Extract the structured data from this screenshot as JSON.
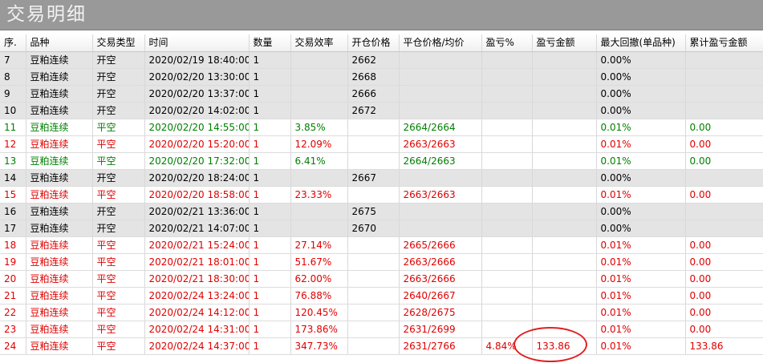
{
  "window": {
    "title": "交易明细"
  },
  "table": {
    "columns": [
      {
        "key": "seq",
        "label": "序."
      },
      {
        "key": "product",
        "label": "品种"
      },
      {
        "key": "trade_type",
        "label": "交易类型"
      },
      {
        "key": "time",
        "label": "时间"
      },
      {
        "key": "qty",
        "label": "数量"
      },
      {
        "key": "efficiency",
        "label": "交易效率"
      },
      {
        "key": "open_price",
        "label": "开仓价格"
      },
      {
        "key": "close_avg",
        "label": "平仓价格/均价"
      },
      {
        "key": "pnl_pct",
        "label": "盈亏%"
      },
      {
        "key": "pnl_amount",
        "label": "盈亏金额"
      },
      {
        "key": "max_drawdown",
        "label": "最大回撤(单品种)"
      },
      {
        "key": "cum_pnl",
        "label": "累计盈亏金额"
      }
    ],
    "rows": [
      {
        "status": "pending",
        "cells": [
          "7",
          "豆粕连续",
          "开空",
          "2020/02/19 18:40:00",
          "1",
          "",
          "2662",
          "",
          "",
          "",
          "0.00%",
          ""
        ]
      },
      {
        "status": "pending",
        "cells": [
          "8",
          "豆粕连续",
          "开空",
          "2020/02/20 13:30:00",
          "1",
          "",
          "2668",
          "",
          "",
          "",
          "0.00%",
          ""
        ]
      },
      {
        "status": "pending",
        "cells": [
          "9",
          "豆粕连续",
          "开空",
          "2020/02/20 13:37:00",
          "1",
          "",
          "2666",
          "",
          "",
          "",
          "0.00%",
          ""
        ]
      },
      {
        "status": "pending",
        "cells": [
          "10",
          "豆粕连续",
          "开空",
          "2020/02/20 14:02:00",
          "1",
          "",
          "2672",
          "",
          "",
          "",
          "0.00%",
          ""
        ]
      },
      {
        "status": "profit",
        "cells": [
          "11",
          "豆粕连续",
          "平空",
          "2020/02/20 14:55:00",
          "1",
          "3.85%",
          "",
          "2664/2664",
          "",
          "",
          "0.01%",
          "0.00"
        ]
      },
      {
        "status": "loss",
        "cells": [
          "12",
          "豆粕连续",
          "平空",
          "2020/02/20 15:20:00",
          "1",
          "12.09%",
          "",
          "2663/2663",
          "",
          "",
          "0.01%",
          "0.00"
        ]
      },
      {
        "status": "profit",
        "cells": [
          "13",
          "豆粕连续",
          "平空",
          "2020/02/20 17:32:00",
          "1",
          "6.41%",
          "",
          "2664/2663",
          "",
          "",
          "0.01%",
          "0.00"
        ]
      },
      {
        "status": "pending",
        "cells": [
          "14",
          "豆粕连续",
          "开空",
          "2020/02/20 18:24:00",
          "1",
          "",
          "2667",
          "",
          "",
          "",
          "0.00%",
          ""
        ]
      },
      {
        "status": "loss",
        "cells": [
          "15",
          "豆粕连续",
          "平空",
          "2020/02/20 18:58:00",
          "1",
          "23.33%",
          "",
          "2663/2663",
          "",
          "",
          "0.01%",
          "0.00"
        ]
      },
      {
        "status": "pending",
        "cells": [
          "16",
          "豆粕连续",
          "开空",
          "2020/02/21 13:36:00",
          "1",
          "",
          "2675",
          "",
          "",
          "",
          "0.00%",
          ""
        ]
      },
      {
        "status": "pending",
        "cells": [
          "17",
          "豆粕连续",
          "开空",
          "2020/02/21 14:07:00",
          "1",
          "",
          "2670",
          "",
          "",
          "",
          "0.00%",
          ""
        ]
      },
      {
        "status": "loss",
        "cells": [
          "18",
          "豆粕连续",
          "平空",
          "2020/02/21 15:24:00",
          "1",
          "27.14%",
          "",
          "2665/2666",
          "",
          "",
          "0.01%",
          "0.00"
        ]
      },
      {
        "status": "loss",
        "cells": [
          "19",
          "豆粕连续",
          "平空",
          "2020/02/21 18:01:00",
          "1",
          "51.67%",
          "",
          "2663/2666",
          "",
          "",
          "0.01%",
          "0.00"
        ]
      },
      {
        "status": "loss",
        "cells": [
          "20",
          "豆粕连续",
          "平空",
          "2020/02/21 18:30:00",
          "1",
          "62.00%",
          "",
          "2663/2666",
          "",
          "",
          "0.01%",
          "0.00"
        ]
      },
      {
        "status": "loss",
        "cells": [
          "21",
          "豆粕连续",
          "平空",
          "2020/02/24 13:24:00",
          "1",
          "76.88%",
          "",
          "2640/2667",
          "",
          "",
          "0.01%",
          "0.00"
        ]
      },
      {
        "status": "loss",
        "cells": [
          "22",
          "豆粕连续",
          "平空",
          "2020/02/24 14:12:00",
          "1",
          "120.45%",
          "",
          "2628/2675",
          "",
          "",
          "0.01%",
          "0.00"
        ]
      },
      {
        "status": "loss",
        "cells": [
          "23",
          "豆粕连续",
          "平空",
          "2020/02/24 14:31:00",
          "1",
          "173.86%",
          "",
          "2631/2699",
          "",
          "",
          "0.01%",
          "0.00"
        ]
      },
      {
        "status": "loss",
        "cells": [
          "24",
          "豆粕连续",
          "平空",
          "2020/02/24 14:37:00",
          "1",
          "347.73%",
          "",
          "2631/2766",
          "4.84%",
          "133.86",
          "0.01%",
          "133.86"
        ]
      }
    ]
  },
  "colors": {
    "title_bar": "#999999",
    "pending_row": "#e4e4e4",
    "profit_text": "#008000",
    "loss_text": "#e00000",
    "annotation_ring": "#e02020"
  }
}
